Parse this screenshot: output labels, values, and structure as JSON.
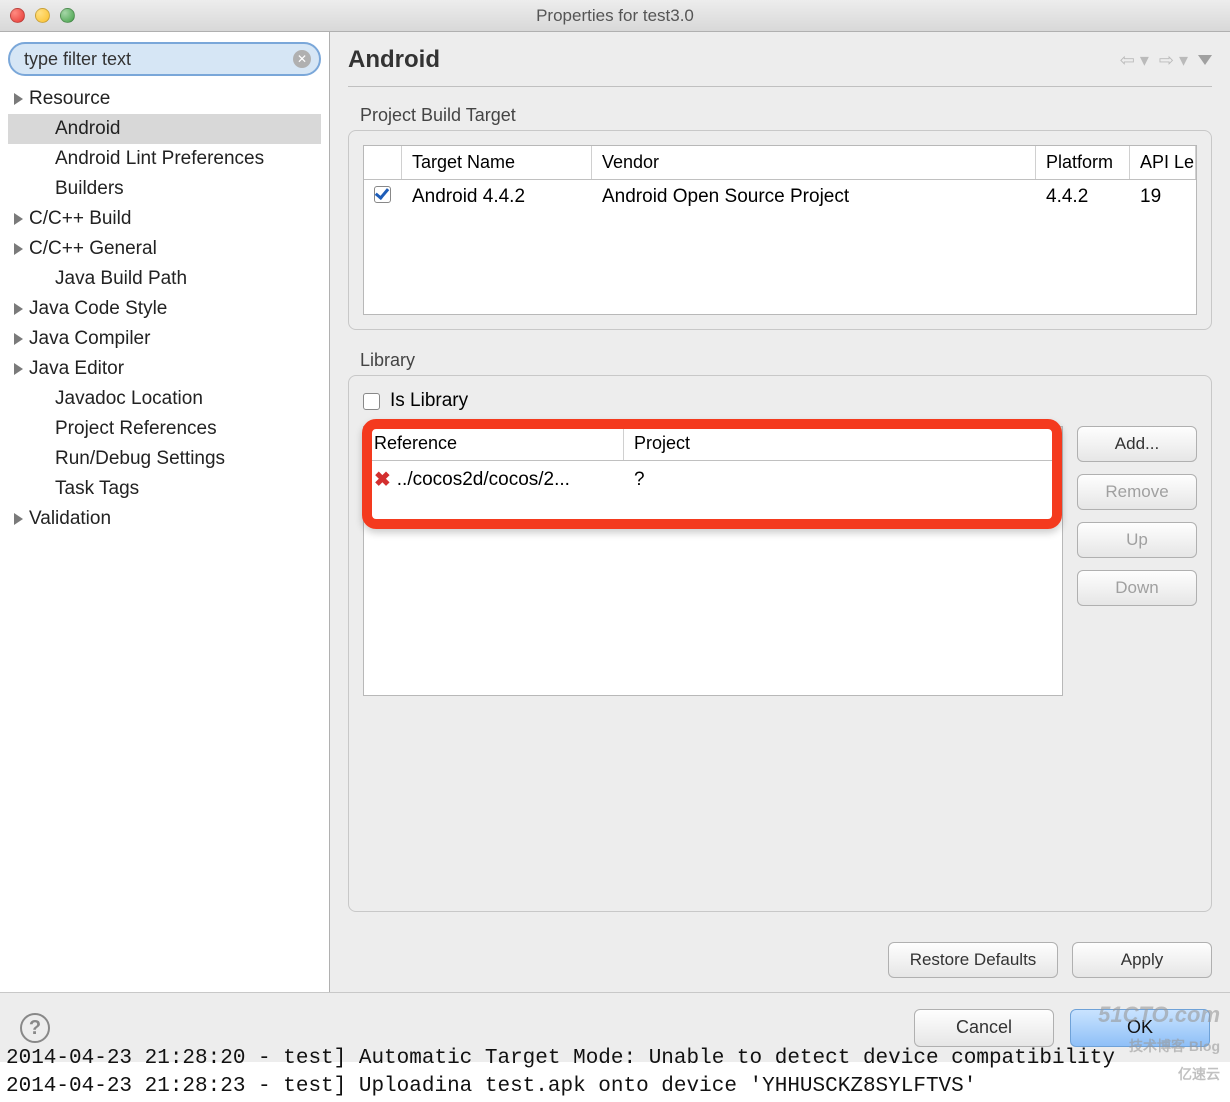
{
  "window": {
    "title": "Properties for test3.0"
  },
  "filter": {
    "placeholder": "type filter text",
    "value": "type filter text"
  },
  "tree": [
    {
      "label": "Resource",
      "expandable": true,
      "child": false,
      "selected": false
    },
    {
      "label": "Android",
      "expandable": false,
      "child": true,
      "selected": true
    },
    {
      "label": "Android Lint Preferences",
      "expandable": false,
      "child": true,
      "selected": false
    },
    {
      "label": "Builders",
      "expandable": false,
      "child": true,
      "selected": false
    },
    {
      "label": "C/C++ Build",
      "expandable": true,
      "child": false,
      "selected": false
    },
    {
      "label": "C/C++ General",
      "expandable": true,
      "child": false,
      "selected": false
    },
    {
      "label": "Java Build Path",
      "expandable": false,
      "child": true,
      "selected": false
    },
    {
      "label": "Java Code Style",
      "expandable": true,
      "child": false,
      "selected": false
    },
    {
      "label": "Java Compiler",
      "expandable": true,
      "child": false,
      "selected": false
    },
    {
      "label": "Java Editor",
      "expandable": true,
      "child": false,
      "selected": false
    },
    {
      "label": "Javadoc Location",
      "expandable": false,
      "child": true,
      "selected": false
    },
    {
      "label": "Project References",
      "expandable": false,
      "child": true,
      "selected": false
    },
    {
      "label": "Run/Debug Settings",
      "expandable": false,
      "child": true,
      "selected": false
    },
    {
      "label": "Task Tags",
      "expandable": false,
      "child": true,
      "selected": false
    },
    {
      "label": "Validation",
      "expandable": true,
      "child": false,
      "selected": false
    }
  ],
  "page": {
    "title": "Android"
  },
  "build_target": {
    "group_label": "Project Build Target",
    "columns": {
      "target": "Target Name",
      "vendor": "Vendor",
      "platform": "Platform",
      "api": "API Le"
    },
    "rows": [
      {
        "checked": true,
        "target": "Android 4.4.2",
        "vendor": "Android Open Source Project",
        "platform": "4.4.2",
        "api": "19"
      }
    ]
  },
  "library": {
    "group_label": "Library",
    "is_library_label": "Is Library",
    "is_library_checked": false,
    "columns": {
      "reference": "Reference",
      "project": "Project"
    },
    "rows": [
      {
        "error": true,
        "reference": "../cocos2d/cocos/2...",
        "project": "?"
      }
    ],
    "buttons": {
      "add": "Add...",
      "remove": "Remove",
      "up": "Up",
      "down": "Down"
    }
  },
  "defaults": {
    "restore": "Restore Defaults",
    "apply": "Apply"
  },
  "bottom": {
    "cancel": "Cancel",
    "ok": "OK"
  },
  "console": {
    "line1": "2014-04-23 21:28:20 - test] Automatic Target Mode: Unable to detect device compatibility",
    "line2": "2014-04-23 21:28:23 - test] Uploadina test.apk onto device 'YHHUSCKZ8SYLFTVS'"
  },
  "watermarks": {
    "top": "51CTO.com",
    "mid": "技术博客 Blog",
    "bot": "亿速云"
  }
}
